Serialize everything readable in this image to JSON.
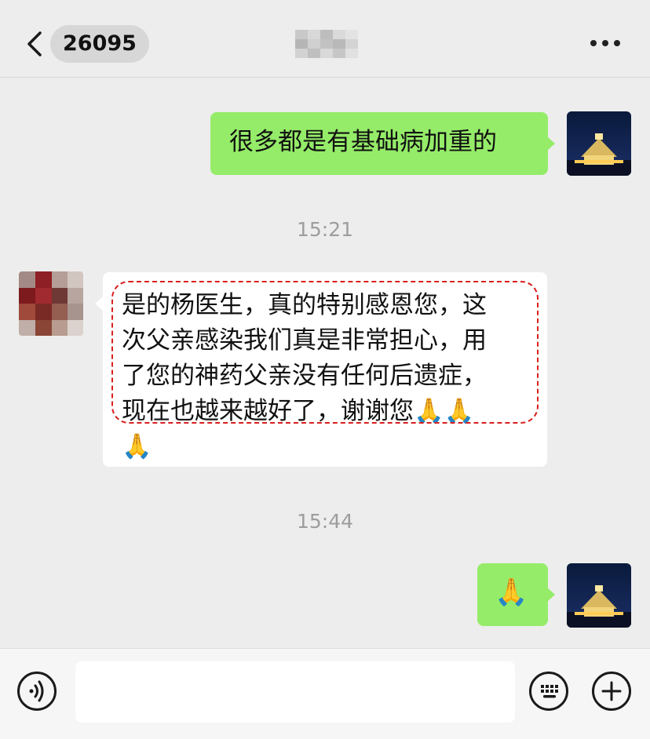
{
  "header": {
    "unread_count": "26095",
    "contact_name": ""
  },
  "messages": [
    {
      "type": "sent",
      "text": "很多都是有基础病加重的"
    },
    {
      "type": "timestamp",
      "text": "15:21"
    },
    {
      "type": "received",
      "lines": [
        "是的杨医生，真的特别感恩您，这",
        "次父亲感染我们真是非常担心，用",
        "了您的神药父亲没有任何后遗症，",
        "现在也越来越好了，谢谢您🙏🙏",
        "🙏"
      ]
    },
    {
      "type": "timestamp",
      "text": "15:44"
    },
    {
      "type": "sent",
      "text": "🙏"
    }
  ],
  "input": {
    "placeholder": ""
  },
  "icons": {
    "back": "chevron-left-icon",
    "more": "more-dots-icon",
    "voice": "voice-icon",
    "keyboard": "keyboard-icon",
    "plus": "plus-icon"
  },
  "colors": {
    "background": "#ededed",
    "sent_bubble": "#95ec69",
    "received_bubble": "#ffffff",
    "highlight_box": "#d81e1e",
    "timestamp_text": "#9d9d9d"
  }
}
